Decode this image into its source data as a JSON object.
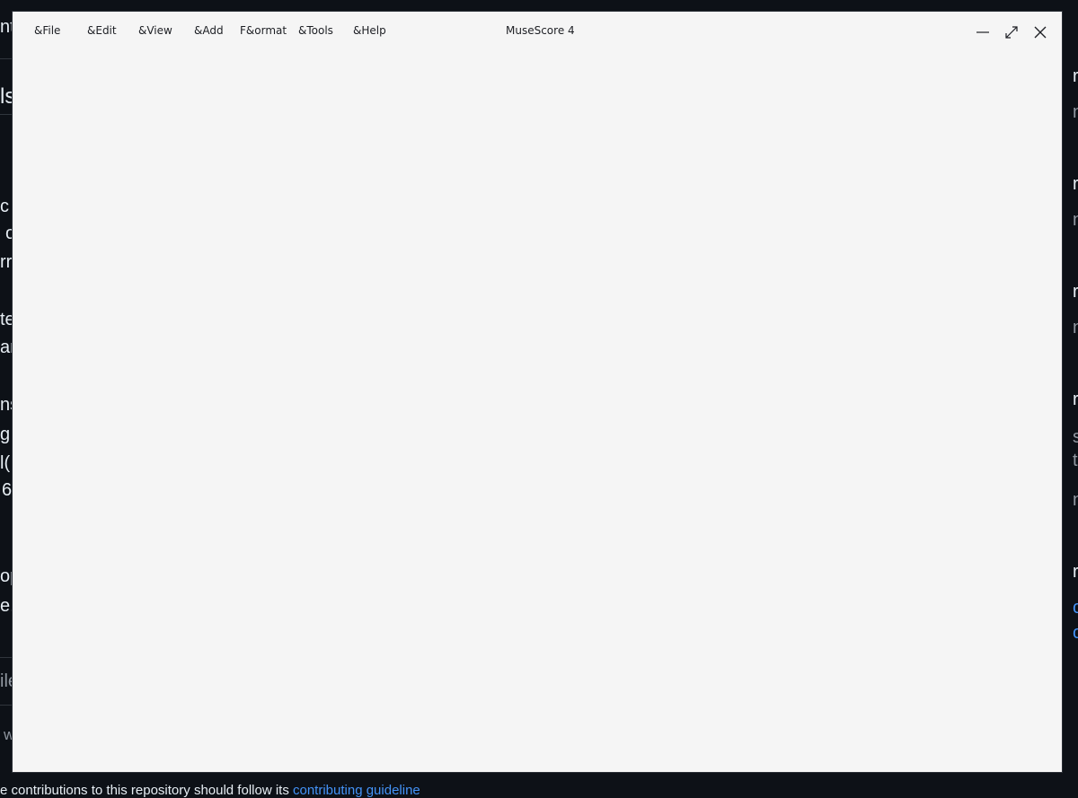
{
  "window": {
    "title": "MuseScore 4",
    "menu": [
      {
        "label": "&File"
      },
      {
        "label": "&Edit"
      },
      {
        "label": "&View"
      },
      {
        "label": "&Add"
      },
      {
        "label": "F&ormat"
      },
      {
        "label": "&Tools"
      },
      {
        "label": "&Help"
      }
    ],
    "controls": {
      "minimize_icon": "minimize-icon",
      "maximize_icon": "maximize-icon",
      "close_icon": "close-icon"
    },
    "colors": {
      "window_bg": "#f5f5f5",
      "text": "#1d1f24",
      "desktop_bg": "#0d1117"
    }
  },
  "background": {
    "left_fragments": [
      "nt",
      "ls",
      "c",
      "o",
      "rr",
      "te",
      "ar",
      "ns",
      "g",
      "l(",
      "6",
      "op",
      "e.g",
      "ile",
      "w"
    ],
    "right_fragments": [
      "r",
      "n",
      "r",
      "n",
      "r",
      "n",
      "r",
      "s",
      "t",
      "n",
      "r",
      "c",
      "c"
    ],
    "bottom_text": "e contributions to this repository should follow its",
    "bottom_link": "contributing guideline"
  }
}
